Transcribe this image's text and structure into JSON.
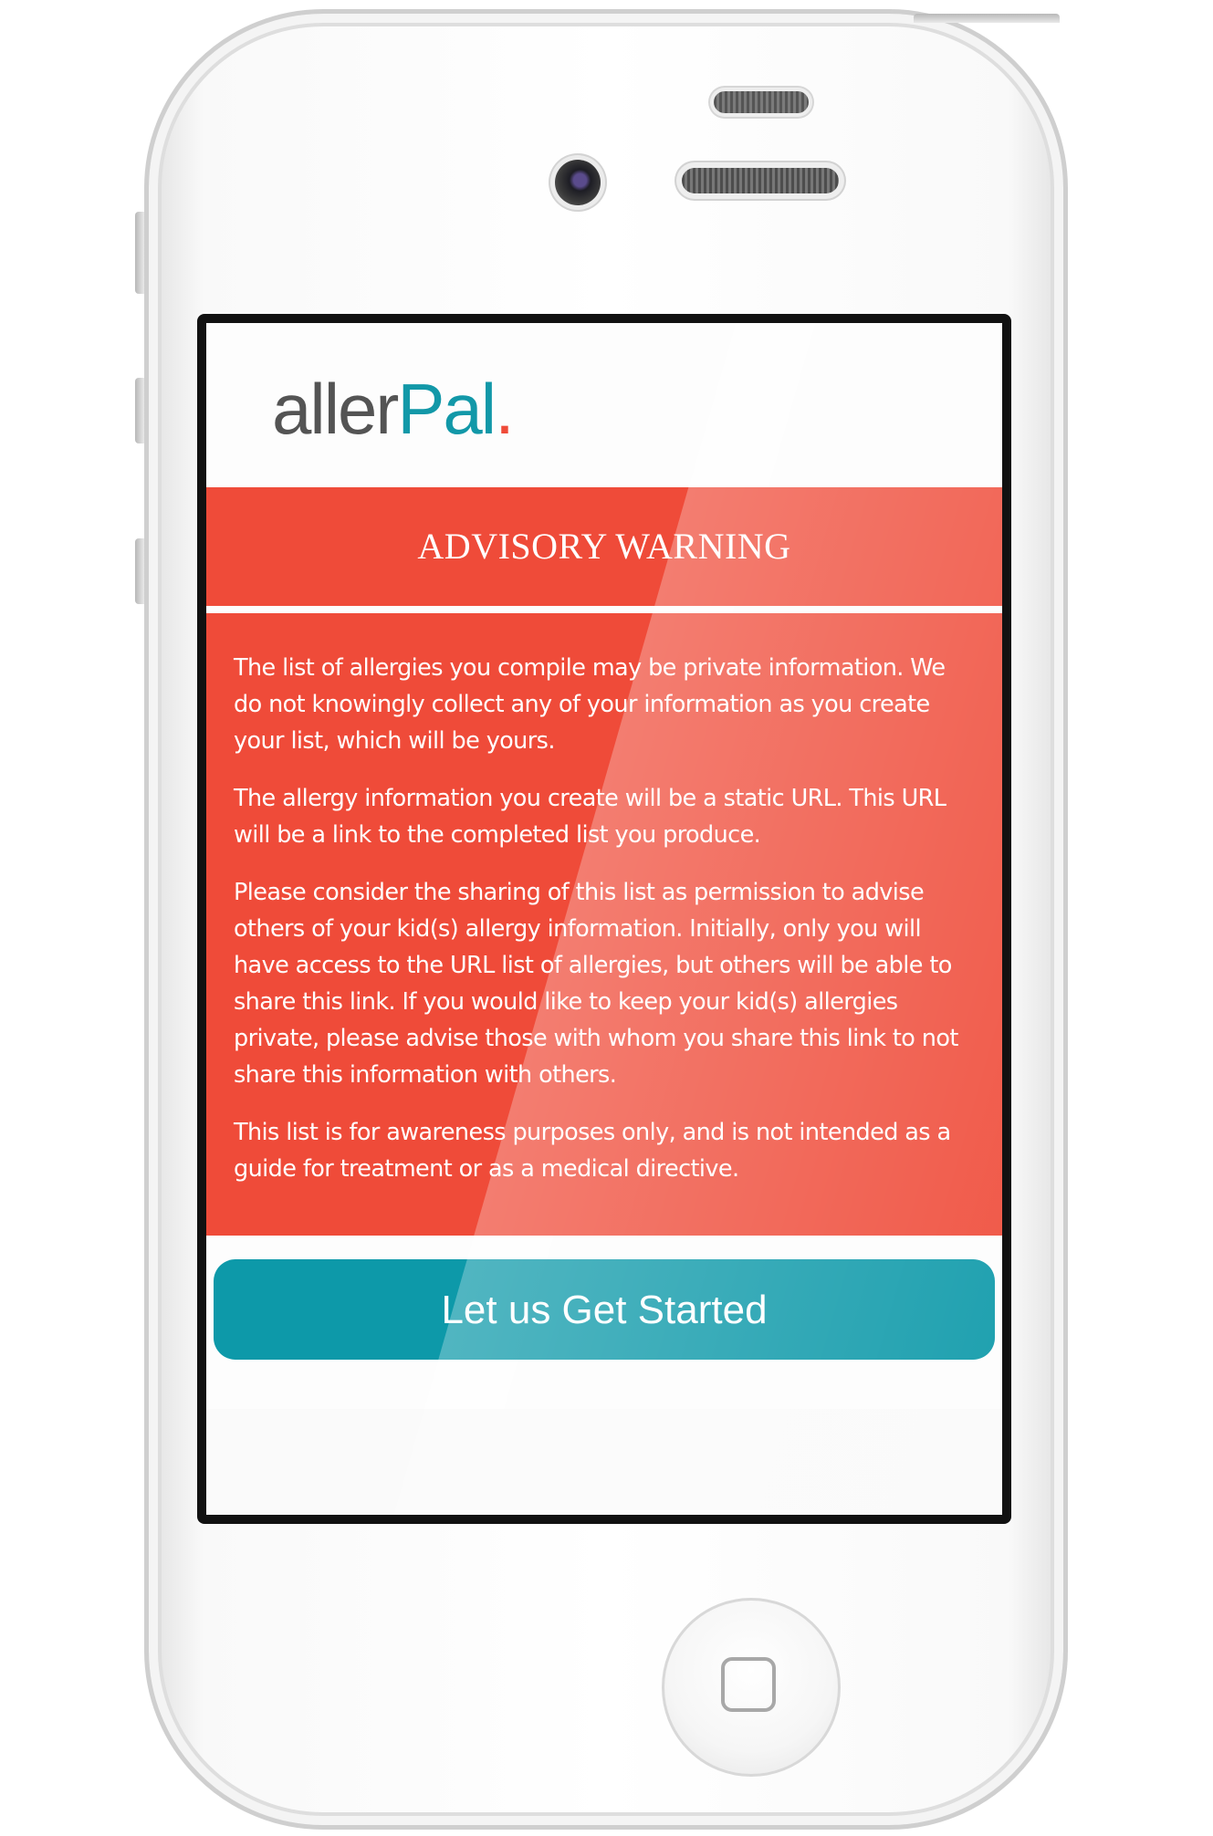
{
  "app": {
    "logo": {
      "part1": "aller",
      "part2": "Pal",
      "part3": "."
    }
  },
  "warning": {
    "title": "ADVISORY WARNING",
    "paragraphs": [
      "The list of allergies you compile may be private information. We do not knowingly collect any of your information as you create your list, which will be yours.",
      "The allergy information you create will be a static URL. This URL will be a link to the completed list you produce.",
      "Please consider the sharing of this list as permission to advise others of your kid(s) allergy information. Initially, only you will have access to the URL list of allergies, but others will be able to share this link. If you would like to keep your kid(s) allergies private, please advise those with whom you share this link to not share this information with others.",
      "This list is for awareness purposes only, and is not intended as a guide for treatment or as a medical directive."
    ]
  },
  "actions": {
    "start_label": "Let us Get Started"
  },
  "colors": {
    "warning": "#ef4b39",
    "accent": "#0d99a9",
    "logo_gray": "#545454"
  }
}
